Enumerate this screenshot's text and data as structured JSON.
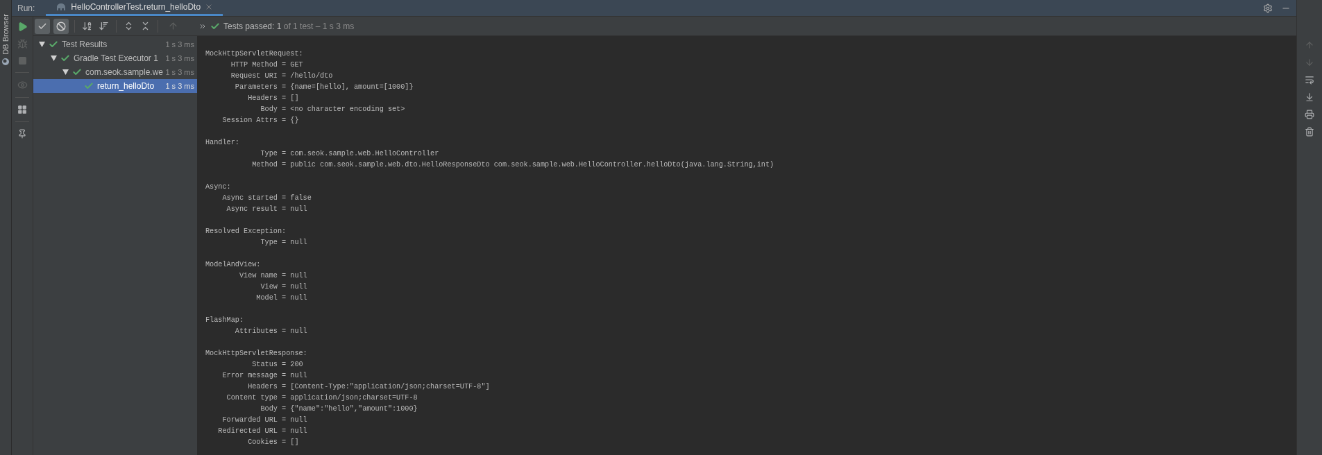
{
  "side_strip": {
    "label": "DB Browser"
  },
  "run_header": {
    "label": "Run:",
    "tabs": [
      {
        "label": "HelloControllerTest.return_helloDto",
        "selected": true
      }
    ]
  },
  "filters": [
    {
      "kind": "passed",
      "on": true
    },
    {
      "kind": "ignored",
      "on": true
    }
  ],
  "status": {
    "label": "Tests passed:",
    "count": "1",
    "rest": "of 1 test – 1 s 3 ms"
  },
  "tree": [
    {
      "label": "Test Results",
      "time": "1 s 3 ms",
      "selected": false,
      "expanded": true,
      "children": [
        {
          "label": "Gradle Test Executor 1",
          "time": "1 s 3 ms",
          "selected": false,
          "expanded": true,
          "children": [
            {
              "label": "com.seok.sample.we",
              "time": "1 s 3 ms",
              "selected": false,
              "expanded": true,
              "children": [
                {
                  "label": "return_helloDto",
                  "time": "1 s 3 ms",
                  "selected": true
                }
              ]
            }
          ]
        }
      ]
    }
  ],
  "console": {
    "groups": [
      {
        "heading": "MockHttpServletRequest:",
        "lines": [
          "      HTTP Method = GET",
          "      Request URI = /hello/dto",
          "       Parameters = {name=[hello], amount=[1000]}",
          "          Headers = []",
          "             Body = <no character encoding set>",
          "    Session Attrs = {}"
        ]
      },
      {
        "heading": "Handler:",
        "lines": [
          "             Type = com.seok.sample.web.HelloController",
          "           Method = public com.seok.sample.web.dto.HelloResponseDto com.seok.sample.web.HelloController.helloDto(java.lang.String,int)"
        ]
      },
      {
        "heading": "Async:",
        "lines": [
          "    Async started = false",
          "     Async result = null"
        ]
      },
      {
        "heading": "Resolved Exception:",
        "lines": [
          "             Type = null"
        ]
      },
      {
        "heading": "ModelAndView:",
        "lines": [
          "        View name = null",
          "             View = null",
          "            Model = null"
        ]
      },
      {
        "heading": "FlashMap:",
        "lines": [
          "       Attributes = null"
        ]
      },
      {
        "heading": "MockHttpServletResponse:",
        "lines": [
          "           Status = 200",
          "    Error message = null",
          "          Headers = [Content-Type:\"application/json;charset=UTF-8\"]",
          "     Content type = application/json;charset=UTF-8",
          "             Body = {\"name\":\"hello\",\"amount\":1000}",
          "    Forwarded URL = null",
          "   Redirected URL = null",
          "          Cookies = []"
        ]
      }
    ]
  }
}
